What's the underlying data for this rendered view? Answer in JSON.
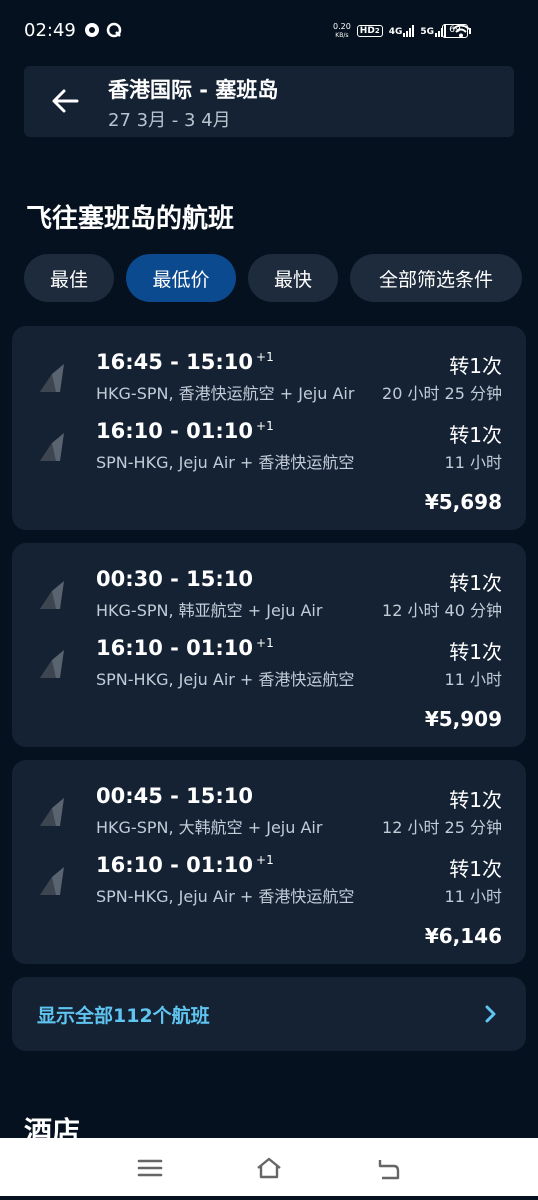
{
  "status_bar": {
    "time": "02:49",
    "net_speed_value": "0.20",
    "net_speed_unit": "KB/s",
    "hd_label": "HD",
    "hd_sub": "2",
    "net_4g": "4G",
    "net_5g": "5G",
    "battery": "69"
  },
  "header": {
    "route": "香港国际 - 塞班岛",
    "dates": "27 3月 - 3 4月"
  },
  "section_title": "飞往塞班岛的航班",
  "filters": [
    {
      "label": "最佳",
      "active": false
    },
    {
      "label": "最低价",
      "active": true
    },
    {
      "label": "最快",
      "active": false
    },
    {
      "label": "全部筛选条件",
      "active": false
    }
  ],
  "flights": [
    {
      "legs": [
        {
          "times": "16:45 - 15:10",
          "plus": "+1",
          "route": "HKG-SPN, 香港快运航空 + Jeju Air",
          "stops": "转1次",
          "duration": "20 小时 25 分钟"
        },
        {
          "times": "16:10 - 01:10",
          "plus": "+1",
          "route": "SPN-HKG, Jeju Air + 香港快运航空",
          "stops": "转1次",
          "duration": "11 小时"
        }
      ],
      "price": "¥5,698"
    },
    {
      "legs": [
        {
          "times": "00:30 - 15:10",
          "plus": "",
          "route": "HKG-SPN, 韩亚航空 + Jeju Air",
          "stops": "转1次",
          "duration": "12 小时 40 分钟"
        },
        {
          "times": "16:10 - 01:10",
          "plus": "+1",
          "route": "SPN-HKG, Jeju Air + 香港快运航空",
          "stops": "转1次",
          "duration": "11 小时"
        }
      ],
      "price": "¥5,909"
    },
    {
      "legs": [
        {
          "times": "00:45 - 15:10",
          "plus": "",
          "route": "HKG-SPN, 大韩航空 + Jeju Air",
          "stops": "转1次",
          "duration": "12 小时 25 分钟"
        },
        {
          "times": "16:10 - 01:10",
          "plus": "+1",
          "route": "SPN-HKG, Jeju Air + 香港快运航空",
          "stops": "转1次",
          "duration": "11 小时"
        }
      ],
      "price": "¥6,146"
    }
  ],
  "show_all": "显示全部112个航班",
  "hotels_title": "酒店",
  "colors": {
    "background": "#05111e",
    "card": "#152233",
    "chip": "#1e2b3c",
    "chip_active": "#0b4a8f",
    "link": "#5fc4f0"
  },
  "icons": {
    "back": "arrow-left-icon",
    "airline": "airline-logo-icon",
    "chevron": "chevron-right-icon",
    "nav_menu": "menu-icon",
    "nav_home": "home-icon",
    "nav_back": "back-icon"
  }
}
